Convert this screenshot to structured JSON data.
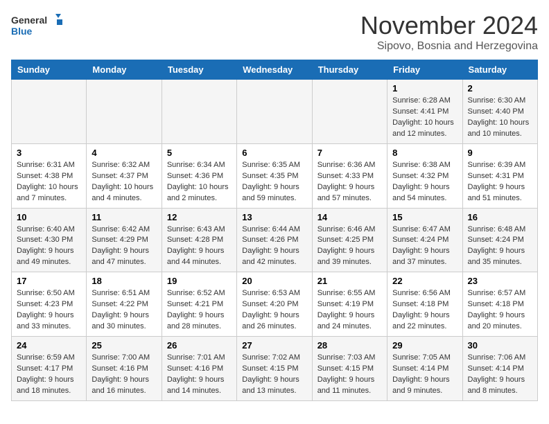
{
  "header": {
    "logo_line1": "General",
    "logo_line2": "Blue",
    "month": "November 2024",
    "location": "Sipovo, Bosnia and Herzegovina"
  },
  "days_of_week": [
    "Sunday",
    "Monday",
    "Tuesday",
    "Wednesday",
    "Thursday",
    "Friday",
    "Saturday"
  ],
  "weeks": [
    [
      {
        "day": "",
        "info": ""
      },
      {
        "day": "",
        "info": ""
      },
      {
        "day": "",
        "info": ""
      },
      {
        "day": "",
        "info": ""
      },
      {
        "day": "",
        "info": ""
      },
      {
        "day": "1",
        "info": "Sunrise: 6:28 AM\nSunset: 4:41 PM\nDaylight: 10 hours and 12 minutes."
      },
      {
        "day": "2",
        "info": "Sunrise: 6:30 AM\nSunset: 4:40 PM\nDaylight: 10 hours and 10 minutes."
      }
    ],
    [
      {
        "day": "3",
        "info": "Sunrise: 6:31 AM\nSunset: 4:38 PM\nDaylight: 10 hours and 7 minutes."
      },
      {
        "day": "4",
        "info": "Sunrise: 6:32 AM\nSunset: 4:37 PM\nDaylight: 10 hours and 4 minutes."
      },
      {
        "day": "5",
        "info": "Sunrise: 6:34 AM\nSunset: 4:36 PM\nDaylight: 10 hours and 2 minutes."
      },
      {
        "day": "6",
        "info": "Sunrise: 6:35 AM\nSunset: 4:35 PM\nDaylight: 9 hours and 59 minutes."
      },
      {
        "day": "7",
        "info": "Sunrise: 6:36 AM\nSunset: 4:33 PM\nDaylight: 9 hours and 57 minutes."
      },
      {
        "day": "8",
        "info": "Sunrise: 6:38 AM\nSunset: 4:32 PM\nDaylight: 9 hours and 54 minutes."
      },
      {
        "day": "9",
        "info": "Sunrise: 6:39 AM\nSunset: 4:31 PM\nDaylight: 9 hours and 51 minutes."
      }
    ],
    [
      {
        "day": "10",
        "info": "Sunrise: 6:40 AM\nSunset: 4:30 PM\nDaylight: 9 hours and 49 minutes."
      },
      {
        "day": "11",
        "info": "Sunrise: 6:42 AM\nSunset: 4:29 PM\nDaylight: 9 hours and 47 minutes."
      },
      {
        "day": "12",
        "info": "Sunrise: 6:43 AM\nSunset: 4:28 PM\nDaylight: 9 hours and 44 minutes."
      },
      {
        "day": "13",
        "info": "Sunrise: 6:44 AM\nSunset: 4:26 PM\nDaylight: 9 hours and 42 minutes."
      },
      {
        "day": "14",
        "info": "Sunrise: 6:46 AM\nSunset: 4:25 PM\nDaylight: 9 hours and 39 minutes."
      },
      {
        "day": "15",
        "info": "Sunrise: 6:47 AM\nSunset: 4:24 PM\nDaylight: 9 hours and 37 minutes."
      },
      {
        "day": "16",
        "info": "Sunrise: 6:48 AM\nSunset: 4:24 PM\nDaylight: 9 hours and 35 minutes."
      }
    ],
    [
      {
        "day": "17",
        "info": "Sunrise: 6:50 AM\nSunset: 4:23 PM\nDaylight: 9 hours and 33 minutes."
      },
      {
        "day": "18",
        "info": "Sunrise: 6:51 AM\nSunset: 4:22 PM\nDaylight: 9 hours and 30 minutes."
      },
      {
        "day": "19",
        "info": "Sunrise: 6:52 AM\nSunset: 4:21 PM\nDaylight: 9 hours and 28 minutes."
      },
      {
        "day": "20",
        "info": "Sunrise: 6:53 AM\nSunset: 4:20 PM\nDaylight: 9 hours and 26 minutes."
      },
      {
        "day": "21",
        "info": "Sunrise: 6:55 AM\nSunset: 4:19 PM\nDaylight: 9 hours and 24 minutes."
      },
      {
        "day": "22",
        "info": "Sunrise: 6:56 AM\nSunset: 4:18 PM\nDaylight: 9 hours and 22 minutes."
      },
      {
        "day": "23",
        "info": "Sunrise: 6:57 AM\nSunset: 4:18 PM\nDaylight: 9 hours and 20 minutes."
      }
    ],
    [
      {
        "day": "24",
        "info": "Sunrise: 6:59 AM\nSunset: 4:17 PM\nDaylight: 9 hours and 18 minutes."
      },
      {
        "day": "25",
        "info": "Sunrise: 7:00 AM\nSunset: 4:16 PM\nDaylight: 9 hours and 16 minutes."
      },
      {
        "day": "26",
        "info": "Sunrise: 7:01 AM\nSunset: 4:16 PM\nDaylight: 9 hours and 14 minutes."
      },
      {
        "day": "27",
        "info": "Sunrise: 7:02 AM\nSunset: 4:15 PM\nDaylight: 9 hours and 13 minutes."
      },
      {
        "day": "28",
        "info": "Sunrise: 7:03 AM\nSunset: 4:15 PM\nDaylight: 9 hours and 11 minutes."
      },
      {
        "day": "29",
        "info": "Sunrise: 7:05 AM\nSunset: 4:14 PM\nDaylight: 9 hours and 9 minutes."
      },
      {
        "day": "30",
        "info": "Sunrise: 7:06 AM\nSunset: 4:14 PM\nDaylight: 9 hours and 8 minutes."
      }
    ]
  ]
}
